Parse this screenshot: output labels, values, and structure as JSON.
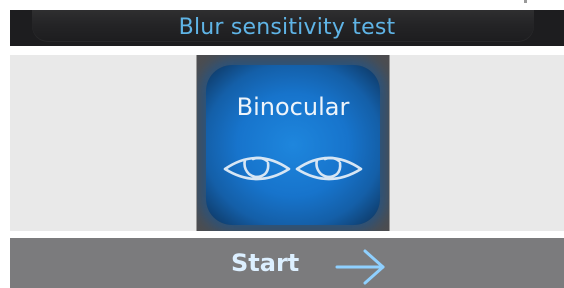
{
  "header": {
    "title": "Blur sensitivity test"
  },
  "mode": {
    "label": "Binocular",
    "icon": "binocular-eyes-icon"
  },
  "footer": {
    "start_label": "Start",
    "icon": "arrow-right-icon"
  },
  "colors": {
    "title_text": "#5fb4e6",
    "accent_glow": "#1e86dd",
    "header_bg": "#1d1d1f",
    "footer_bg": "#7b7b7d",
    "tile_bg": "#4d4d4f",
    "panel_bg": "#e9e9e9"
  }
}
